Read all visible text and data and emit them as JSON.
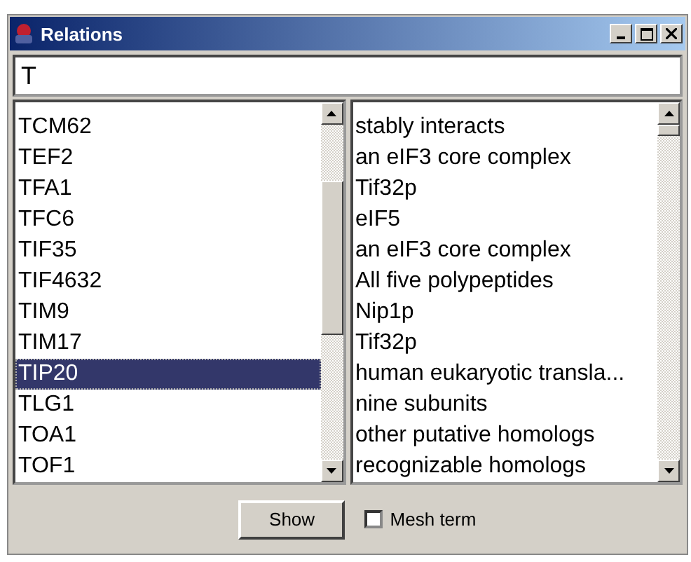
{
  "window": {
    "title": "Relations"
  },
  "search": {
    "value": "T"
  },
  "names": [
    {
      "label": "TCM62",
      "selected": false
    },
    {
      "label": "TEF2",
      "selected": false
    },
    {
      "label": "TFA1",
      "selected": false
    },
    {
      "label": "TFC6",
      "selected": false
    },
    {
      "label": "TIF35",
      "selected": false
    },
    {
      "label": "TIF4632",
      "selected": false
    },
    {
      "label": "TIM9",
      "selected": false
    },
    {
      "label": "TIM17",
      "selected": false
    },
    {
      "label": "TIP20",
      "selected": true
    },
    {
      "label": "TLG1",
      "selected": false
    },
    {
      "label": "TOA1",
      "selected": false
    },
    {
      "label": "TOF1",
      "selected": false
    }
  ],
  "relations": [
    "stably interacts",
    "an eIF3 core complex",
    "Tif32p",
    "eIF5",
    "an eIF3 core complex",
    "All five polypeptides",
    "Nip1p",
    "Tif32p",
    "human eukaryotic transla...",
    "nine subunits",
    "other putative homologs",
    "recognizable homologs"
  ],
  "show_button": "Show",
  "mesh_term": {
    "label": "Mesh term",
    "checked": false
  }
}
